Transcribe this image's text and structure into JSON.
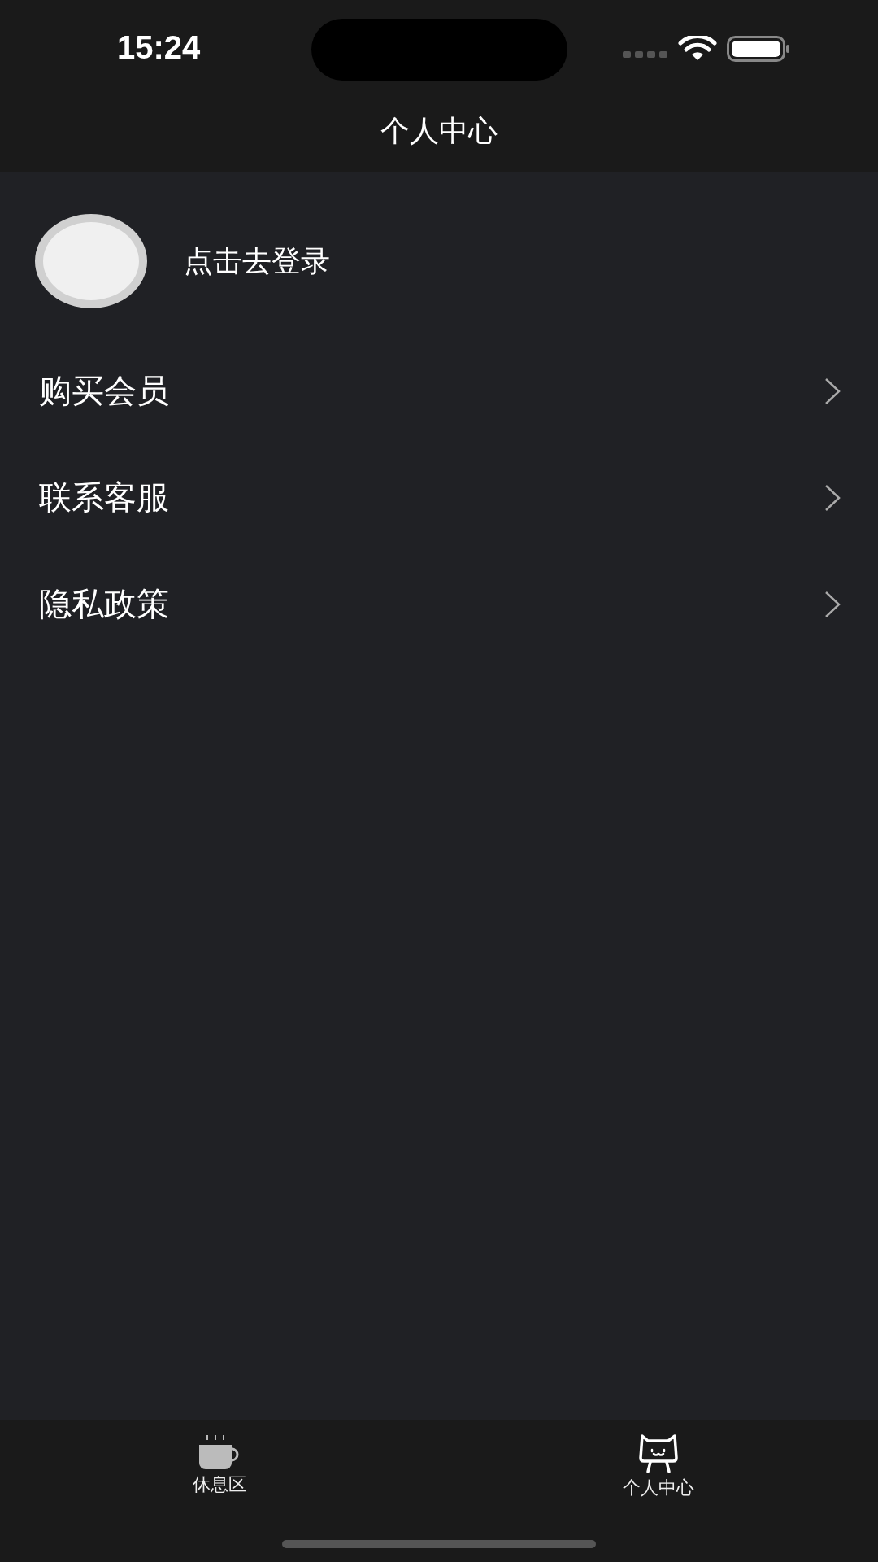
{
  "status_bar": {
    "time": "15:24"
  },
  "nav": {
    "title": "个人中心"
  },
  "profile": {
    "login_text": "点击去登录"
  },
  "menu": [
    {
      "label": "购买会员"
    },
    {
      "label": "联系客服"
    },
    {
      "label": "隐私政策"
    }
  ],
  "tabs": [
    {
      "label": "休息区",
      "kind": "cup",
      "selected": false
    },
    {
      "label": "个人中心",
      "kind": "cat",
      "selected": true
    }
  ]
}
